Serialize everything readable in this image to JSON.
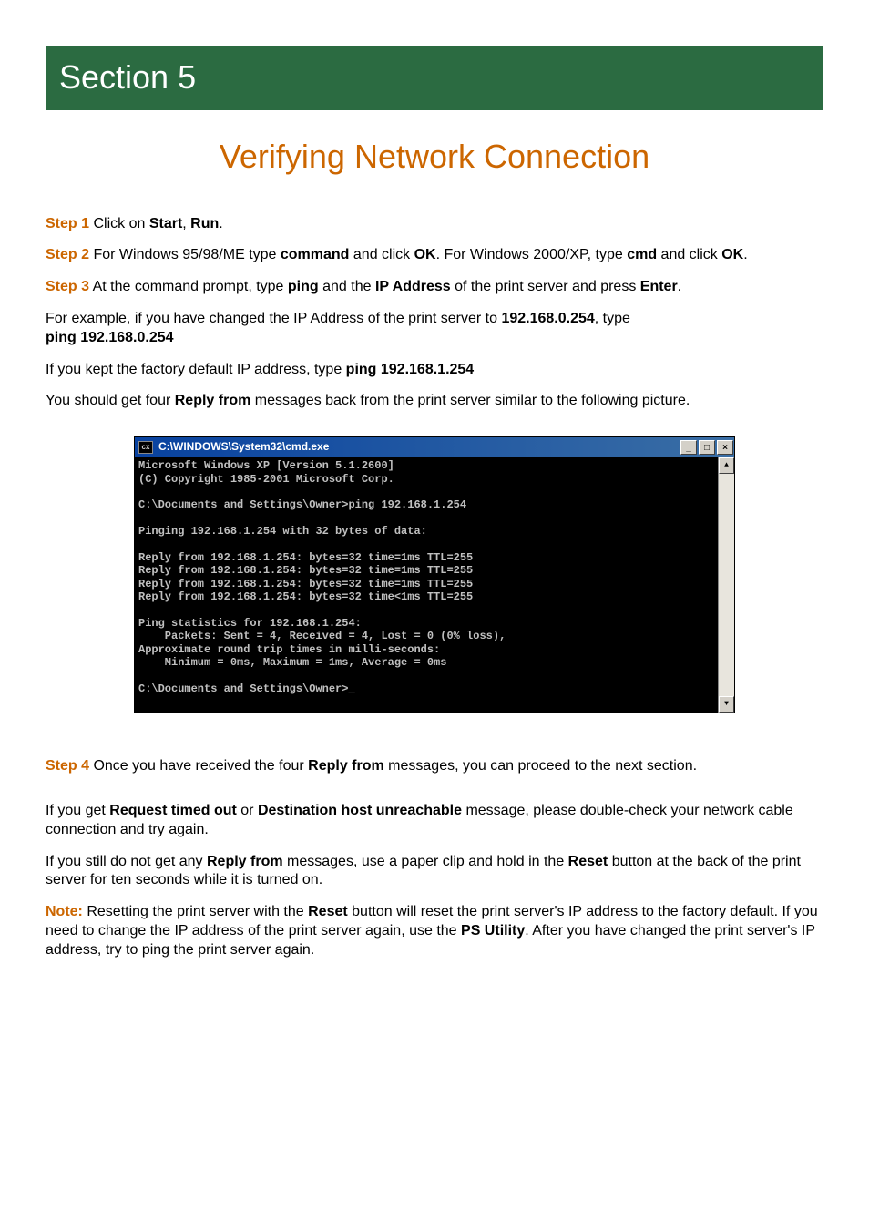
{
  "section": {
    "banner": "Section 5",
    "title": "Verifying Network Connection"
  },
  "steps": {
    "step1": {
      "label": "Step 1",
      "pre": " Click on ",
      "bold1": "Start",
      "sep": ", ",
      "bold2": "Run",
      "post": "."
    },
    "step2": {
      "label": "Step 2",
      "pre": " For Windows 95/98/ME type ",
      "bold1": "command",
      "mid1": " and click ",
      "bold2": "OK",
      "mid2": ". For Windows 2000/XP, type ",
      "bold3": "cmd",
      "mid3": " and click ",
      "bold4": "OK",
      "post": "."
    },
    "step3": {
      "label": "Step 3",
      "pre": " At the command prompt, type ",
      "bold1": "ping",
      "mid1": " and the ",
      "bold2": "IP Address",
      "mid2": " of the print server and press ",
      "bold3": "Enter",
      "post": "."
    },
    "example": {
      "pre": "For example, if you have changed the IP Address of the print server to ",
      "bold1": "192.168.0.254",
      "mid1": ", type",
      "bold2": "ping 192.168.0.254"
    },
    "factory": {
      "pre": "If you kept the factory default IP address, type ",
      "bold1": "ping 192.168.1.254"
    },
    "reply_intro": {
      "pre": "You should get four ",
      "bold1": "Reply from",
      "post": " messages back from the print server similar to the following picture."
    },
    "step4": {
      "label": "Step 4",
      "pre": " Once you have received the four ",
      "bold1": "Reply from",
      "post": " messages, you can proceed to the next section."
    },
    "timeout": {
      "pre": "If you get ",
      "bold1": "Request timed out",
      "mid1": " or ",
      "bold2": "Destination host unreachable",
      "post": " message, please double-check your network cable connection and try again."
    },
    "reset": {
      "pre": "If you still do not get any ",
      "bold1": "Reply from",
      "mid1": " messages, use a paper clip and hold in the ",
      "bold2": "Reset",
      "post": " button at the back of the print server for ten seconds while it is turned on."
    },
    "note": {
      "label": "Note:",
      "pre": " Resetting the print server with the ",
      "bold1": "Reset",
      "mid1": " button will reset the print server's IP address to the factory default. If you need to change the IP address of the print server again, use the ",
      "bold2": "PS Utility",
      "post": ". After you have changed the print server's IP address, try to ping the print server again."
    }
  },
  "cmd": {
    "title": "C:\\WINDOWS\\System32\\cmd.exe",
    "icon_text": "cx",
    "min": "_",
    "max": "□",
    "close": "×",
    "up": "▲",
    "down": "▼",
    "output": "Microsoft Windows XP [Version 5.1.2600]\n(C) Copyright 1985-2001 Microsoft Corp.\n\nC:\\Documents and Settings\\Owner>ping 192.168.1.254\n\nPinging 192.168.1.254 with 32 bytes of data:\n\nReply from 192.168.1.254: bytes=32 time=1ms TTL=255\nReply from 192.168.1.254: bytes=32 time=1ms TTL=255\nReply from 192.168.1.254: bytes=32 time=1ms TTL=255\nReply from 192.168.1.254: bytes=32 time<1ms TTL=255\n\nPing statistics for 192.168.1.254:\n    Packets: Sent = 4, Received = 4, Lost = 0 (0% loss),\nApproximate round trip times in milli-seconds:\n    Minimum = 0ms, Maximum = 1ms, Average = 0ms\n\nC:\\Documents and Settings\\Owner>_"
  }
}
